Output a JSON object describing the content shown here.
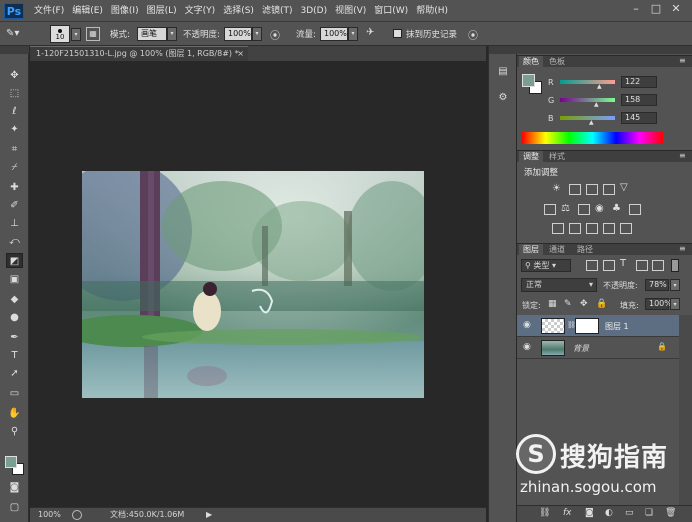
{
  "app": {
    "logo": "Ps"
  },
  "menu": [
    "文件(F)",
    "编辑(E)",
    "图像(I)",
    "图层(L)",
    "文字(Y)",
    "选择(S)",
    "滤镜(T)",
    "3D(D)",
    "视图(V)",
    "窗口(W)",
    "帮助(H)"
  ],
  "window_controls": [
    "–",
    "□",
    "✕"
  ],
  "options": {
    "brush_size": "10",
    "mode_label": "模式:",
    "mode_value": "画笔",
    "opacity_label": "不透明度:",
    "opacity_value": "100%",
    "flow_label": "流量:",
    "flow_value": "100%",
    "history_label": "抹到历史记录"
  },
  "document": {
    "tab_title": "1-120F21501310-L.jpg @ 100% (图层 1, RGB/8#) *",
    "close": "×",
    "zoom": "100%",
    "doc_info": "文档:450.0K/1.06M"
  },
  "color_panel": {
    "tabs": [
      "颜色",
      "色板"
    ],
    "r_label": "R",
    "r_value": "122",
    "g_label": "G",
    "g_value": "158",
    "b_label": "B",
    "b_value": "145",
    "fg_color": "#7a9e91"
  },
  "adjustments_panel": {
    "tabs": [
      "调整",
      "样式"
    ],
    "heading": "添加调整"
  },
  "layers_panel": {
    "tabs": [
      "图层",
      "通道",
      "路径"
    ],
    "filter_label": "类型",
    "blend_mode": "正常",
    "opacity_label": "不透明度:",
    "opacity_value": "78%",
    "lock_label": "锁定:",
    "fill_label": "填充:",
    "fill_value": "100%",
    "layers": [
      {
        "name": "图层 1"
      },
      {
        "name": "背景"
      }
    ],
    "footer_icons": [
      "link-icon",
      "fx-icon",
      "mask-icon",
      "adjustment-icon",
      "folder-icon",
      "new-layer-icon",
      "trash-icon"
    ]
  },
  "watermark": {
    "brand": "搜狗指南",
    "url": "zhinan.sogou.com"
  }
}
